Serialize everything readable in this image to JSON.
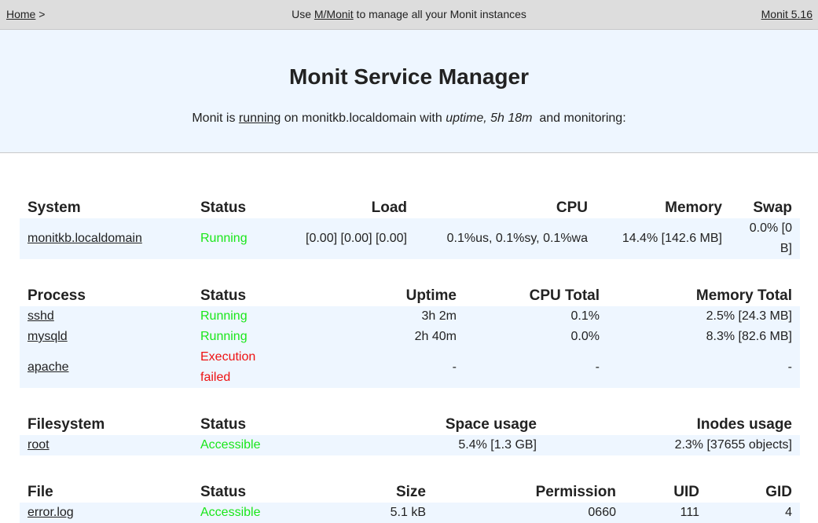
{
  "topbar": {
    "home": "Home",
    "home_sep": " >",
    "center_pre": "Use ",
    "center_link": "M/Monit",
    "center_post": " to manage all your Monit instances",
    "version": "Monit 5.16"
  },
  "header": {
    "title": "Monit Service Manager",
    "sub_pre": "Monit is ",
    "sub_link": "running",
    "sub_mid": " on monitkb.localdomain with ",
    "sub_uptime": "uptime, 5h 18m",
    "sub_post": "  and monitoring:"
  },
  "colors": {
    "running": "#19e619",
    "failed": "#ee1111",
    "row_bg": "#eef6ff"
  },
  "system": {
    "headers": [
      "System",
      "Status",
      "Load",
      "CPU",
      "Memory",
      "Swap"
    ],
    "rows": [
      {
        "name": "monitkb.localdomain",
        "status": "Running",
        "load": "[0.00] [0.00] [0.00]",
        "cpu": "0.1%us, 0.1%sy, 0.1%wa",
        "memory": "14.4% [142.6 MB]",
        "swap": "0.0% [0 B]"
      }
    ]
  },
  "process": {
    "headers": [
      "Process",
      "Status",
      "Uptime",
      "CPU Total",
      "Memory Total"
    ],
    "rows": [
      {
        "name": "sshd",
        "status": "Running",
        "uptime": "3h 2m",
        "cpu": "0.1%",
        "memory": "2.5% [24.3 MB]"
      },
      {
        "name": "mysqld",
        "status": "Running",
        "uptime": "2h 40m",
        "cpu": "0.0%",
        "memory": "8.3% [82.6 MB]"
      },
      {
        "name": "apache",
        "status": "Execution failed",
        "uptime": "-",
        "cpu": "-",
        "memory": "-"
      }
    ]
  },
  "filesystem": {
    "headers": [
      "Filesystem",
      "Status",
      "Space usage",
      "Inodes usage"
    ],
    "rows": [
      {
        "name": "root",
        "status": "Accessible",
        "space": "5.4% [1.3 GB]",
        "inodes": "2.3% [37655 objects]"
      }
    ]
  },
  "file": {
    "headers": [
      "File",
      "Status",
      "Size",
      "Permission",
      "UID",
      "GID"
    ],
    "rows": [
      {
        "name": "error.log",
        "status": "Accessible",
        "size": "5.1 kB",
        "permission": "0660",
        "uid": "111",
        "gid": "4"
      }
    ]
  }
}
